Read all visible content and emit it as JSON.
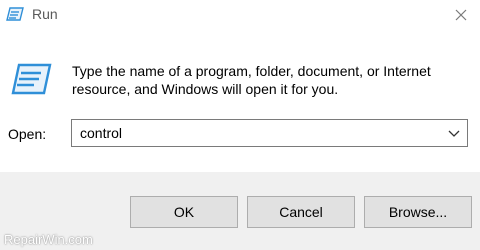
{
  "window": {
    "title": "Run",
    "icon": "run-app-icon",
    "close_icon": "close-icon"
  },
  "body": {
    "icon": "run-app-icon",
    "message_line1": "Type the name of a program, folder, document, or Internet",
    "message_line2": "resource, and Windows will open it for you."
  },
  "open_field": {
    "label": "Open:",
    "value": "control",
    "dropdown_icon": "chevron-down-icon"
  },
  "buttons": {
    "ok": "OK",
    "cancel": "Cancel",
    "browse": "Browse..."
  },
  "watermark": "RepairWin.com",
  "colors": {
    "footer_bg": "#f0f0f0",
    "button_bg": "#e1e1e1",
    "icon_blue": "#2f8fd8"
  }
}
